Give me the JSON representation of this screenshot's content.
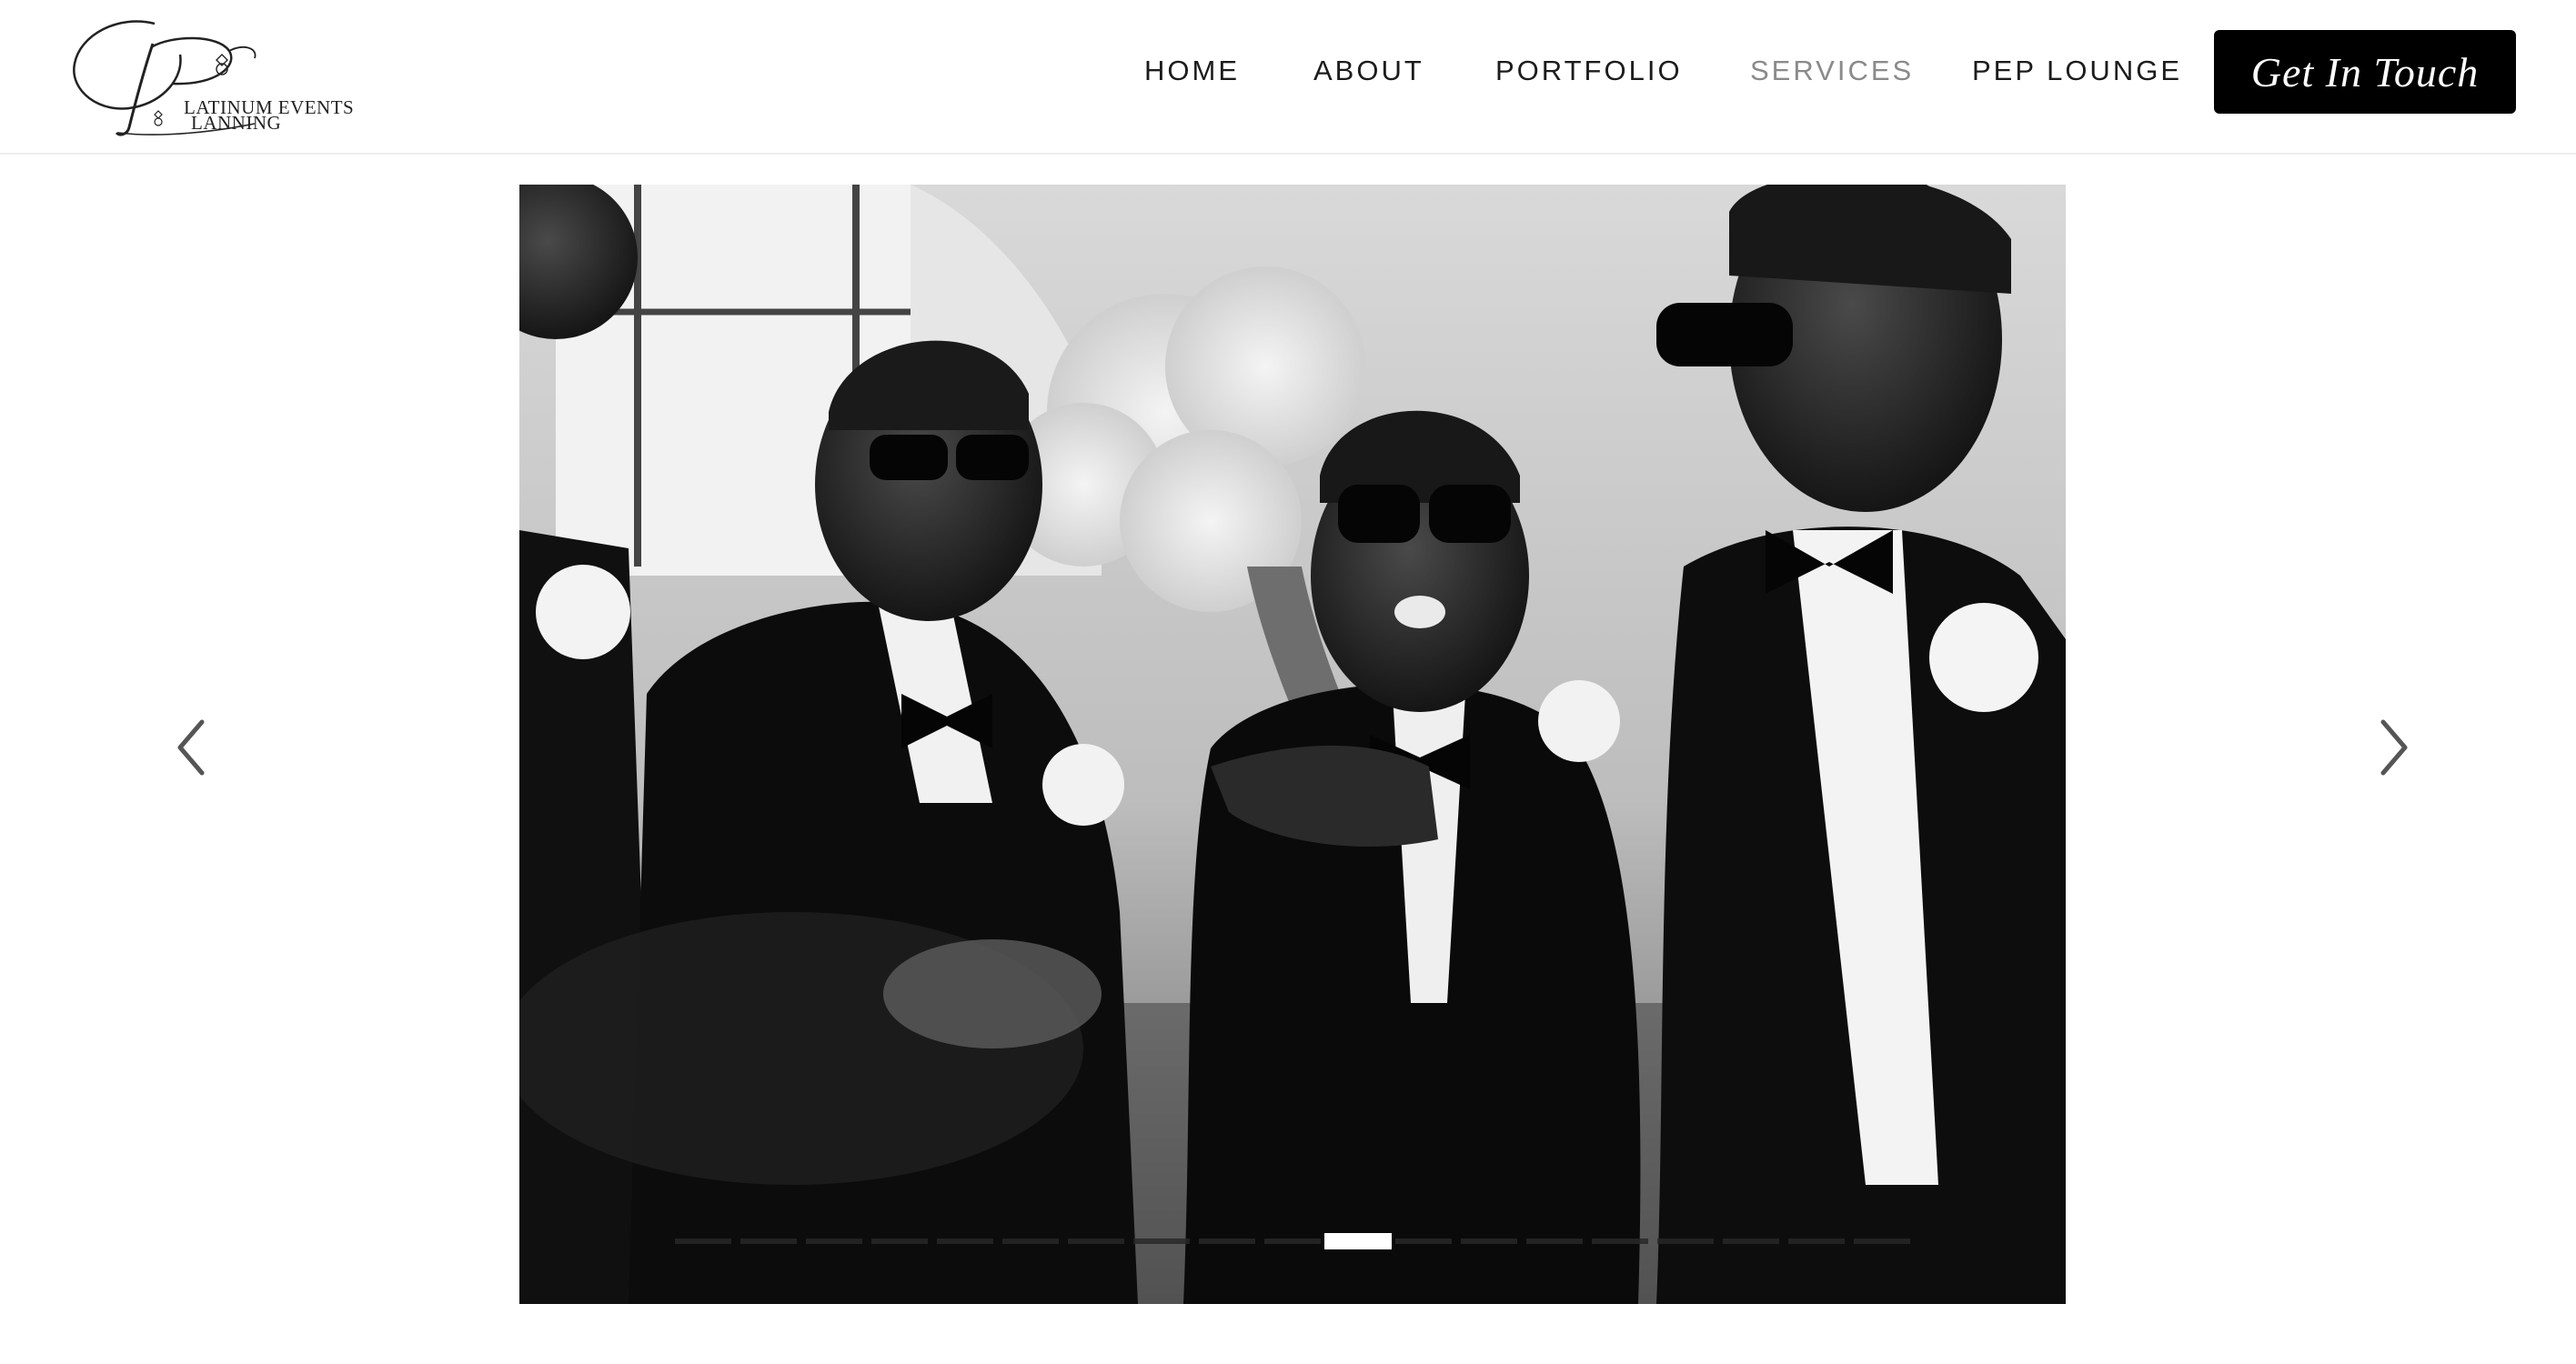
{
  "logo": {
    "line1": "LATINUM EVENTS",
    "line2": "LANNING"
  },
  "nav": {
    "items": [
      {
        "label": "HOME",
        "active": false
      },
      {
        "label": "ABOUT",
        "active": false
      },
      {
        "label": "PORTFOLIO",
        "active": false
      },
      {
        "label": "SERVICES",
        "active": true
      },
      {
        "label": "PEP LOUNGE",
        "active": false
      }
    ],
    "cta_label": "Get In Touch"
  },
  "slider": {
    "image": "black-and-white photo of groomsmen in tuxedos and sunglasses celebrating",
    "slide_count": 19,
    "active_index": 10,
    "prev_icon": "chevron-left-icon",
    "next_icon": "chevron-right-icon"
  },
  "colors": {
    "text": "#1c1c1c",
    "active_nav": "#8a8a8a",
    "cta_bg": "#000000",
    "cta_text": "#ffffff"
  }
}
